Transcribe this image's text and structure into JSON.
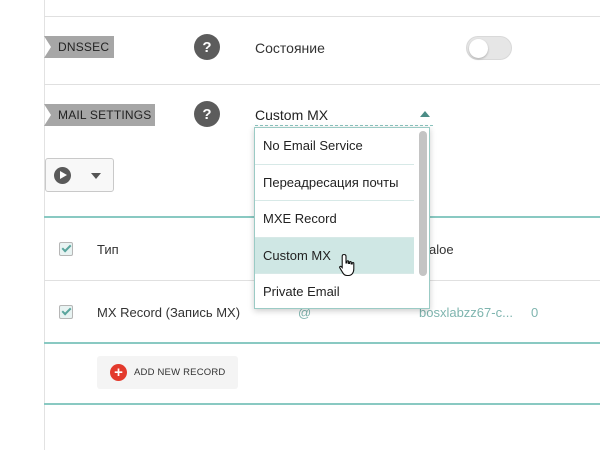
{
  "dnssec": {
    "label": "DNSSEC",
    "help_icon": "?",
    "status_label": "Состояние",
    "toggle_on": false
  },
  "mail_settings": {
    "label": "MAIL SETTINGS",
    "help_icon": "?",
    "selected_value": "Custom MX",
    "options": [
      "No Email Service",
      "Переадресация почты",
      "MXE  Record",
      "Custom MX",
      "Private Email"
    ],
    "highlighted_option": "Custom MX"
  },
  "toolbar": {
    "play_icon": "play-icon",
    "dropdown_icon": "chevron-down-icon"
  },
  "table": {
    "headers": {
      "type": "Тип",
      "value": "aloe"
    },
    "rows": [
      {
        "checked": true,
        "type": "MX Record (Запись MX)",
        "host": "@",
        "value": "bosxlabzz67-c...",
        "priority": "0"
      }
    ]
  },
  "add_record": {
    "label": "ADD NEW RECORD",
    "icon": "+"
  },
  "colors": {
    "accent_teal": "#89c9c2",
    "label_gray": "#a6a6a6",
    "add_red": "#e33a2d"
  }
}
